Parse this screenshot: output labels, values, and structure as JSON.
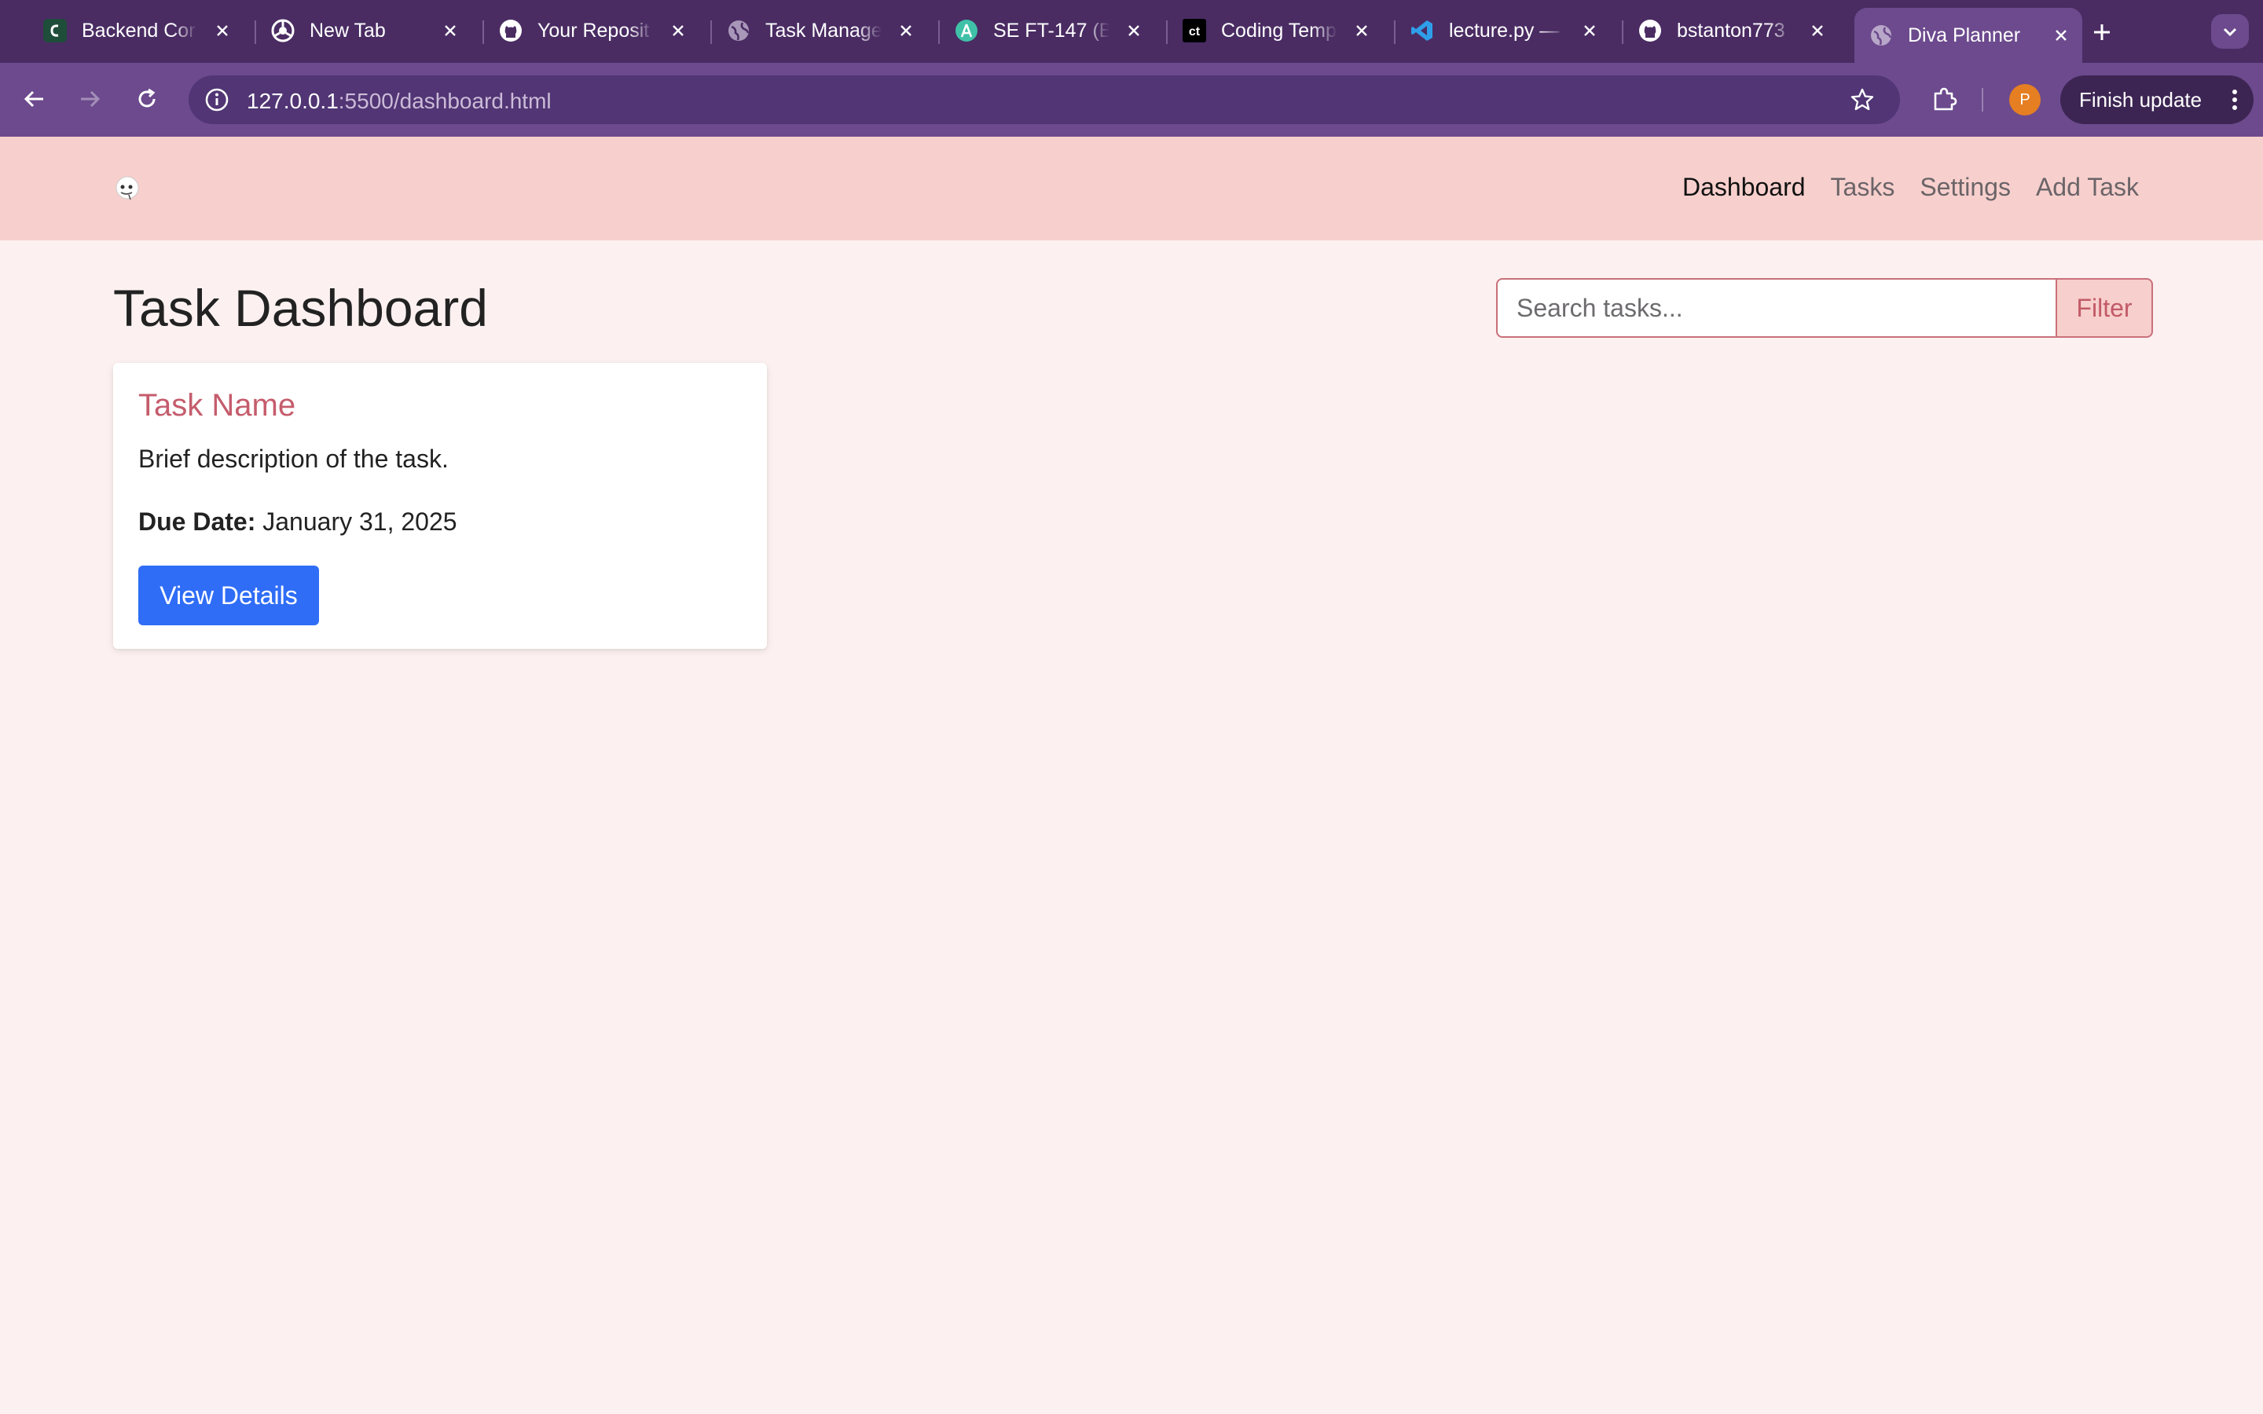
{
  "browser": {
    "tabs": [
      {
        "title": "Backend Cor",
        "icon": "backend-favicon",
        "active": false
      },
      {
        "title": "New Tab",
        "icon": "chrome-icon",
        "active": false
      },
      {
        "title": "Your Reposit",
        "icon": "github-icon",
        "active": false
      },
      {
        "title": "Task Manage",
        "icon": "globe-icon",
        "active": false
      },
      {
        "title": "SE FT-147 (B",
        "icon": "course-favicon",
        "active": false
      },
      {
        "title": "Coding Temp",
        "icon": "ct-favicon",
        "ct_text": "ct",
        "active": false
      },
      {
        "title": "lecture.py —",
        "icon": "vscode-icon",
        "active": false
      },
      {
        "title": "bstanton773",
        "icon": "github-icon",
        "active": false
      },
      {
        "title": "Diva Planner",
        "icon": "globe-icon",
        "active": true
      }
    ],
    "url_host": "127.0.0.1",
    "url_path": ":5500/dashboard.html",
    "profile_initial": "P",
    "update_label": "Finish update"
  },
  "navbar": {
    "links": [
      {
        "label": "Dashboard",
        "active": true
      },
      {
        "label": "Tasks",
        "active": false
      },
      {
        "label": "Settings",
        "active": false
      },
      {
        "label": "Add Task",
        "active": false
      }
    ]
  },
  "page": {
    "title": "Task Dashboard",
    "search_placeholder": "Search tasks...",
    "filter_label": "Filter"
  },
  "task_card": {
    "name": "Task Name",
    "description": "Brief description of the task.",
    "due_label": "Due Date:",
    "due_date": "January 31, 2025",
    "button_label": "View Details"
  },
  "colors": {
    "tabstrip": "#4a2c63",
    "toolbar": "#6c4a8d",
    "navbar": "#f7d0cd",
    "page_bg": "#fcf1f0",
    "task_name": "#c55c6c",
    "primary_button": "#2f6df6",
    "filter_text": "#c25a67"
  }
}
